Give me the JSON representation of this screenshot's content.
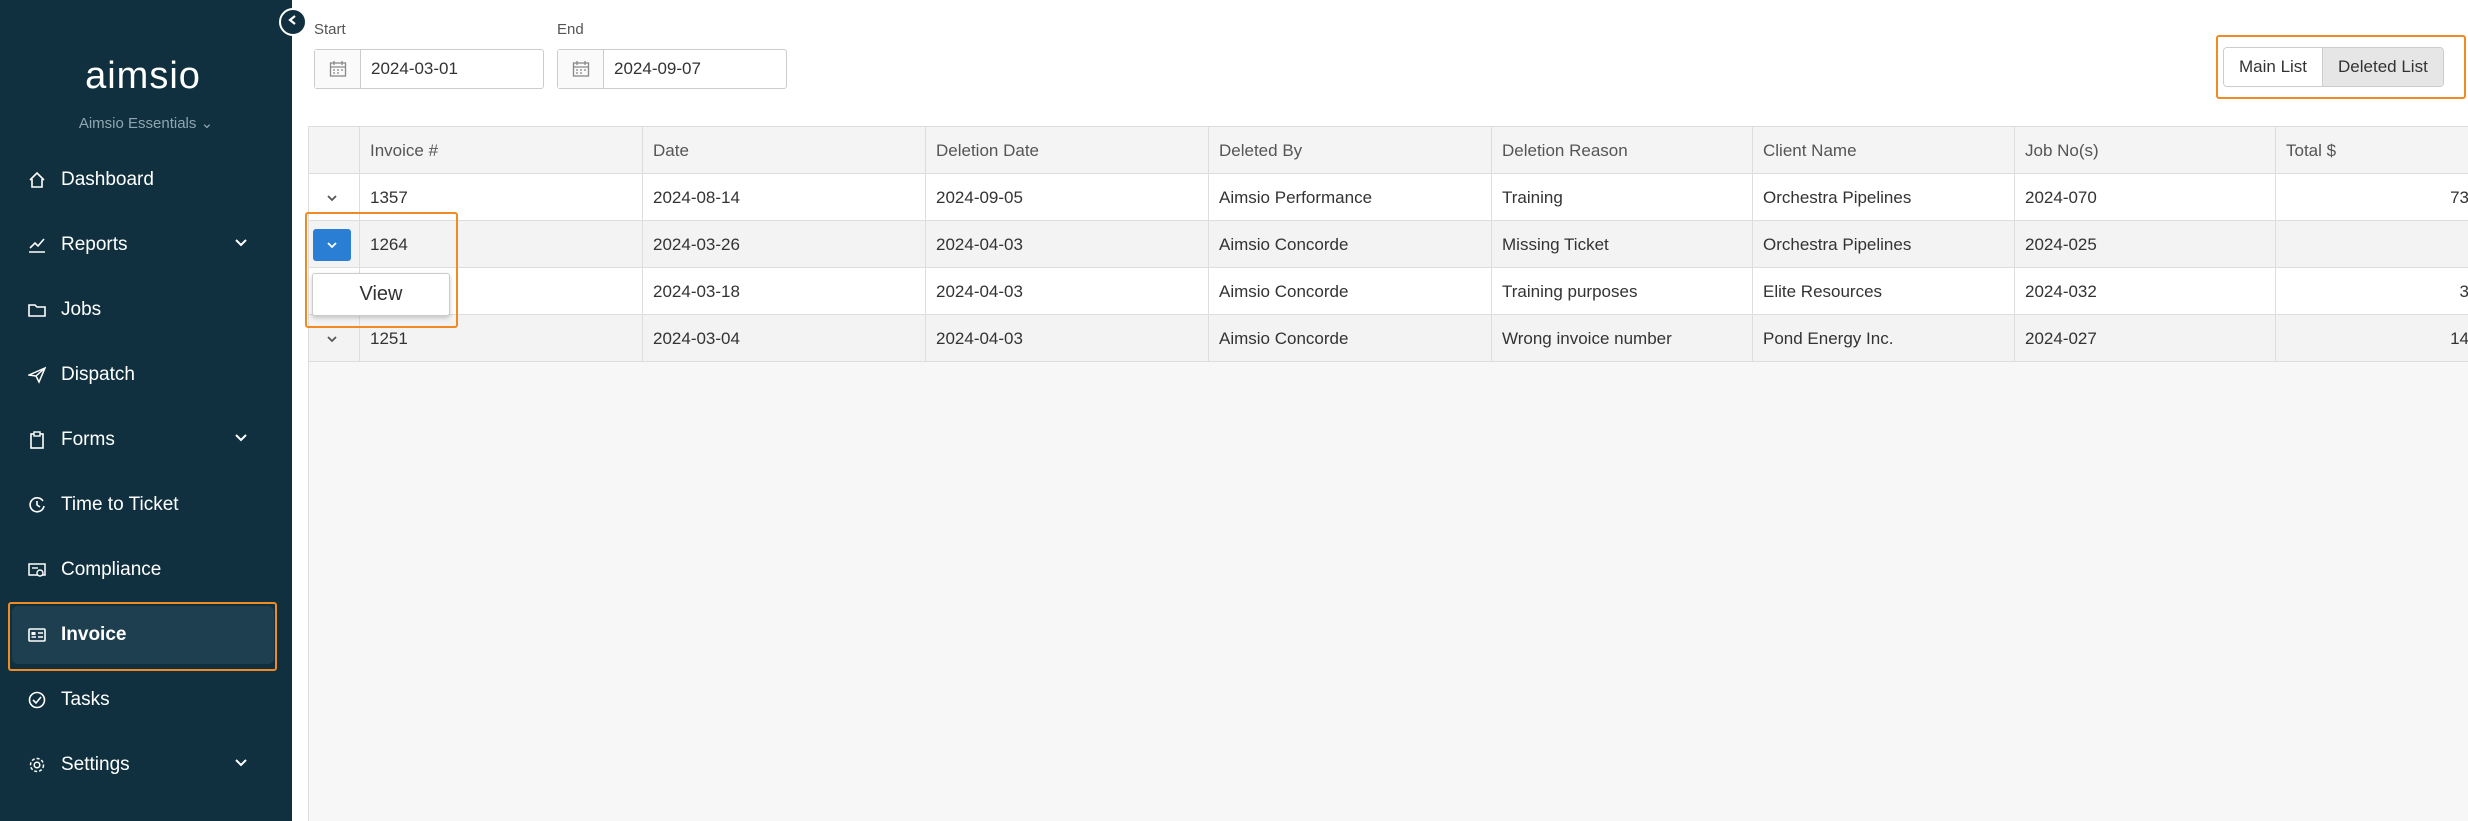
{
  "app": {
    "logo_text": "aimsio",
    "workspace": "Aimsio Essentials"
  },
  "sidebar": {
    "items": [
      {
        "label": "Dashboard",
        "icon": "home-icon",
        "has_submenu": false
      },
      {
        "label": "Reports",
        "icon": "chart-icon",
        "has_submenu": true
      },
      {
        "label": "Jobs",
        "icon": "folder-icon",
        "has_submenu": false
      },
      {
        "label": "Dispatch",
        "icon": "send-icon",
        "has_submenu": false
      },
      {
        "label": "Forms",
        "icon": "clipboard-icon",
        "has_submenu": true
      },
      {
        "label": "Time to Ticket",
        "icon": "refresh-clock-icon",
        "has_submenu": false
      },
      {
        "label": "Compliance",
        "icon": "certificate-icon",
        "has_submenu": false
      },
      {
        "label": "Invoice",
        "icon": "invoice-icon",
        "has_submenu": false,
        "active": true
      },
      {
        "label": "Tasks",
        "icon": "check-circle-icon",
        "has_submenu": false
      },
      {
        "label": "Settings",
        "icon": "gear-icon",
        "has_submenu": true
      }
    ]
  },
  "filters": {
    "start_label": "Start",
    "start_value": "2024-03-01",
    "end_label": "End",
    "end_value": "2024-09-07"
  },
  "list_toggle": {
    "main_label": "Main List",
    "deleted_label": "Deleted List",
    "selected": "Deleted List"
  },
  "table": {
    "columns": [
      "Invoice #",
      "Date",
      "Deletion Date",
      "Deleted By",
      "Deletion Reason",
      "Client Name",
      "Job No(s)",
      "Total $"
    ],
    "rows": [
      {
        "invoice": "1357",
        "date": "2024-08-14",
        "deletion_date": "2024-09-05",
        "deleted_by": "Aimsio Performance",
        "reason": "Training",
        "client": "Orchestra Pipelines",
        "jobs": "2024-070",
        "total": "73"
      },
      {
        "invoice": "1264",
        "date": "2024-03-26",
        "deletion_date": "2024-04-03",
        "deleted_by": "Aimsio Concorde",
        "reason": "Missing Ticket",
        "client": "Orchestra Pipelines",
        "jobs": "2024-025",
        "total": ""
      },
      {
        "invoice": "",
        "date": "2024-03-18",
        "deletion_date": "2024-04-03",
        "deleted_by": "Aimsio Concorde",
        "reason": "Training purposes",
        "client": "Elite Resources",
        "jobs": "2024-032",
        "total": "3"
      },
      {
        "invoice": "1251",
        "date": "2024-03-04",
        "deletion_date": "2024-04-03",
        "deleted_by": "Aimsio Concorde",
        "reason": "Wrong invoice number",
        "client": "Pond Energy Inc.",
        "jobs": "2024-027",
        "total": "14"
      }
    ]
  },
  "row_menu": {
    "view_label": "View"
  },
  "colors": {
    "sidebar_bg": "#10303f",
    "active_item_bg": "#1e3f4f",
    "highlight": "#f08a24",
    "accent_button": "#2a7fd4"
  }
}
